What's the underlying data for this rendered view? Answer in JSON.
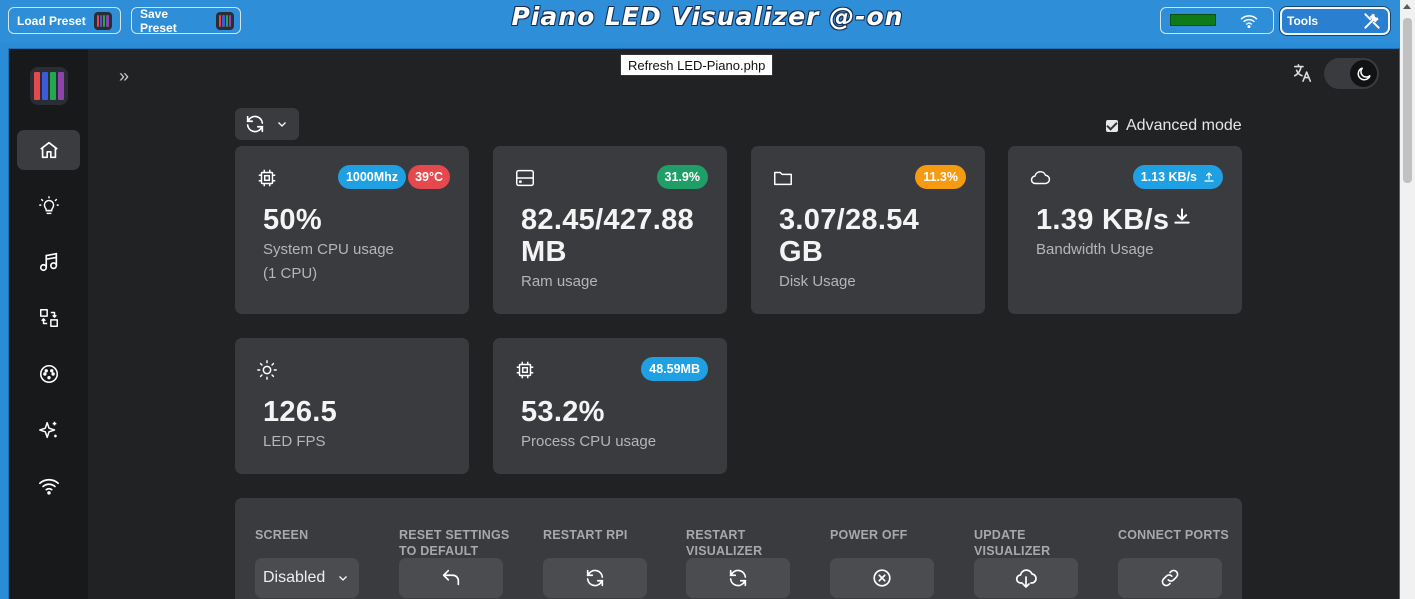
{
  "header": {
    "title": "Piano LED Visualizer @-on",
    "load_preset": "Load Preset",
    "save_preset": "Save Preset",
    "tools": "Tools"
  },
  "tooltip": "Refresh LED-Piano.php",
  "advanced_mode": {
    "label": "Advanced mode",
    "checked": true
  },
  "sidebar": {
    "items": [
      {
        "name": "home",
        "icon": "home-icon",
        "active": true
      },
      {
        "name": "led-settings",
        "icon": "lightbulb-icon"
      },
      {
        "name": "songs",
        "icon": "music-note-icon"
      },
      {
        "name": "sequences",
        "icon": "arrows-exchange-icon"
      },
      {
        "name": "ports",
        "icon": "midi-port-icon"
      },
      {
        "name": "animations",
        "icon": "sparkles-icon"
      },
      {
        "name": "network",
        "icon": "wifi-icon"
      }
    ]
  },
  "stats": {
    "cpu": {
      "value": "50%",
      "label": "System CPU usage",
      "sub": "(1 CPU)",
      "freq": "1000Mhz",
      "temp": "39°C"
    },
    "ram": {
      "value": "82.45/427.88",
      "unit": "MB",
      "label": "Ram usage",
      "percent": "31.9%"
    },
    "disk": {
      "value": "3.07/28.54",
      "unit": "GB",
      "label": "Disk Usage",
      "percent": "11.3%"
    },
    "bandwidth": {
      "value": "1.39 KB/s",
      "label": "Bandwidth Usage",
      "upload": "1.13 KB/s"
    },
    "fps": {
      "value": "126.5",
      "label": "LED FPS"
    },
    "process": {
      "value": "53.2%",
      "label": "Process CPU usage",
      "memory": "48.59MB"
    }
  },
  "controls": {
    "screen": {
      "label": "Screen",
      "value": "Disabled"
    },
    "reset": {
      "label_line1": "Reset settings",
      "label_line2": "to default"
    },
    "restart_rpi": {
      "label": "Restart RPi"
    },
    "restart_visualizer": {
      "label_line1": "Restart",
      "label_line2": "Visualizer"
    },
    "power_off": {
      "label": "Power off"
    },
    "update": {
      "label_line1": "Update",
      "label_line2": "Visualizer"
    },
    "connect_ports": {
      "label": "Connect ports"
    }
  },
  "colors": {
    "accent_blue": "#2e8fd8",
    "badge_blue": "#1fa0e3",
    "badge_red": "#e5484d",
    "badge_green": "#1f9e68",
    "badge_orange": "#f59a11",
    "card_bg": "#3a3b3f"
  }
}
